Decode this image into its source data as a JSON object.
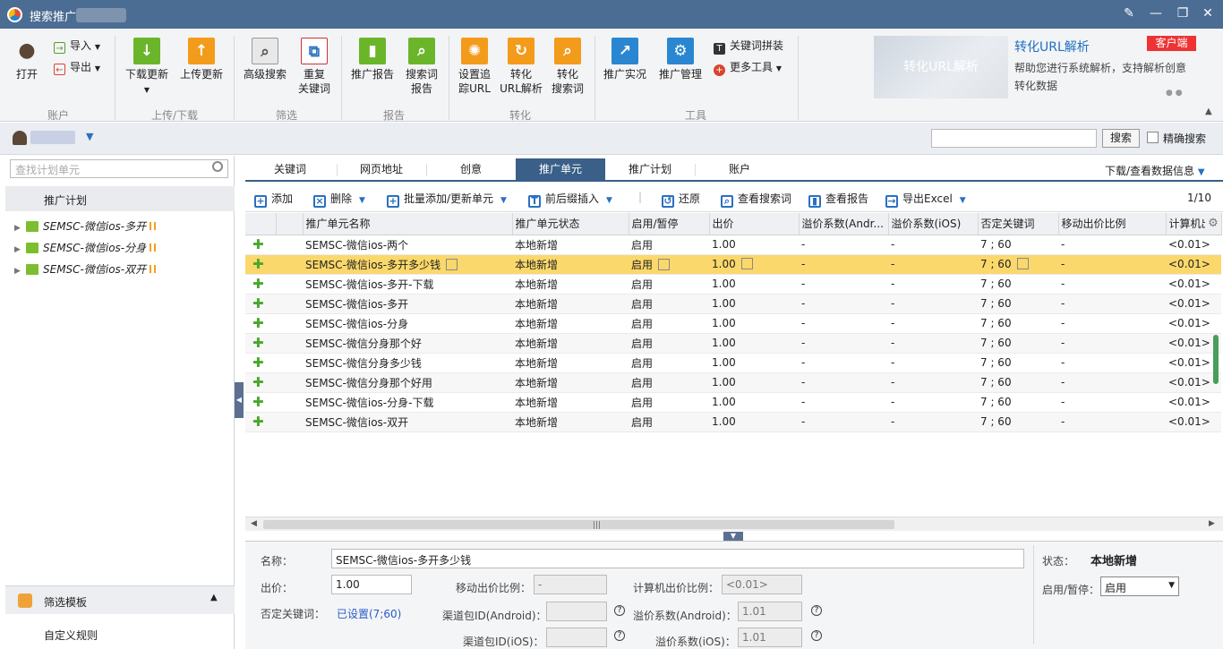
{
  "titlebar": {
    "title": "搜索推广"
  },
  "ribbon": {
    "open": "打开",
    "import": "导入",
    "export": "导出",
    "download_update": "下载更新",
    "upload_update": "上传更新",
    "advanced_search": "高级搜索",
    "repeat_keywords": [
      "重复",
      "关键词"
    ],
    "promo_report": "推广报告",
    "search_term_report": [
      "搜索词",
      "报告"
    ],
    "set_tracking_url": [
      "设置追",
      "踪URL"
    ],
    "convert_url": [
      "转化",
      "URL解析"
    ],
    "convert_search_term": [
      "转化",
      "搜索词"
    ],
    "promo_live": "推广实况",
    "promo_manage": "推广管理",
    "keyword_splice": "关键词拼装",
    "more_tools": "更多工具",
    "groups": [
      "账户",
      "上传/下载",
      "筛选",
      "报告",
      "转化",
      "工具"
    ],
    "banner": {
      "image_text": "转化URL解析",
      "title": "转化URL解析",
      "tag": "客户端",
      "desc": "帮助您进行系统解析，支持解析创意转化数据"
    }
  },
  "userbar": {
    "search_button": "搜索",
    "exact_search": "精确搜索",
    "search_value": ""
  },
  "left": {
    "search_placeholder": "查找计划单元",
    "header": "推广计划",
    "plans": [
      "SEMSC-微信ios-多开",
      "SEMSC-微信ios-分身",
      "SEMSC-微信ios-双开"
    ],
    "filter_template": "筛选模板",
    "custom_rules": "自定义规则"
  },
  "tabs": {
    "items": [
      "关键词",
      "网页地址",
      "创意",
      "推广单元",
      "推广计划",
      "账户"
    ],
    "active": 3,
    "download": "下载/查看数据信息"
  },
  "toolbar": {
    "add": "添加",
    "delete": "删除",
    "batch_add": "批量添加/更新单元",
    "insert": "前后缀插入",
    "restore": "还原",
    "view_search": "查看搜索词",
    "view_report": "查看报告",
    "export": "导出Excel",
    "pager": "1/10"
  },
  "grid": {
    "columns": [
      "推广单元名称",
      "推广单元状态",
      "启用/暂停",
      "出价",
      "溢价系数(Andr...",
      "溢价系数(iOS)",
      "否定关键词",
      "移动出价比例",
      "计算机出"
    ],
    "rows": [
      [
        "SEMSC-微信ios-两个",
        "本地新增",
        "启用",
        "1.00",
        "-",
        "-",
        "7 ; 60",
        "-",
        "<0.01>"
      ],
      [
        "SEMSC-微信ios-多开多少钱",
        "本地新增",
        "启用",
        "1.00",
        "-",
        "-",
        "7 ; 60",
        "-",
        "<0.01>"
      ],
      [
        "SEMSC-微信ios-多开-下载",
        "本地新增",
        "启用",
        "1.00",
        "-",
        "-",
        "7 ; 60",
        "-",
        "<0.01>"
      ],
      [
        "SEMSC-微信ios-多开",
        "本地新增",
        "启用",
        "1.00",
        "-",
        "-",
        "7 ; 60",
        "-",
        "<0.01>"
      ],
      [
        "SEMSC-微信ios-分身",
        "本地新增",
        "启用",
        "1.00",
        "-",
        "-",
        "7 ; 60",
        "-",
        "<0.01>"
      ],
      [
        "SEMSC-微信分身那个好",
        "本地新增",
        "启用",
        "1.00",
        "-",
        "-",
        "7 ; 60",
        "-",
        "<0.01>"
      ],
      [
        "SEMSC-微信分身多少钱",
        "本地新增",
        "启用",
        "1.00",
        "-",
        "-",
        "7 ; 60",
        "-",
        "<0.01>"
      ],
      [
        "SEMSC-微信分身那个好用",
        "本地新增",
        "启用",
        "1.00",
        "-",
        "-",
        "7 ; 60",
        "-",
        "<0.01>"
      ],
      [
        "SEMSC-微信ios-分身-下载",
        "本地新增",
        "启用",
        "1.00",
        "-",
        "-",
        "7 ; 60",
        "-",
        "<0.01>"
      ],
      [
        "SEMSC-微信ios-双开",
        "本地新增",
        "启用",
        "1.00",
        "-",
        "-",
        "7 ; 60",
        "-",
        "<0.01>"
      ]
    ],
    "selected_row": 1
  },
  "detail": {
    "name_label": "名称：",
    "name_value": "SEMSC-微信ios-多开多少钱",
    "bid_label": "出价：",
    "bid_value": "1.00",
    "mobile_ratio_label": "移动出价比例：",
    "mobile_ratio_value": "-",
    "pc_ratio_label": "计算机出价比例：",
    "pc_ratio_value": "<0.01>",
    "neg_kw_label": "否定关键词：",
    "neg_kw_value": "已设置(7;60)",
    "android_pkg_label": "渠道包ID(Android)：",
    "android_prem_label": "溢价系数(Android)：",
    "android_prem_value": "1.01",
    "ios_pkg_label": "渠道包ID(iOS)：",
    "ios_prem_label": "溢价系数(iOS)：",
    "ios_prem_value": "1.01",
    "status_label": "状态：",
    "status_value": "本地新增",
    "enable_label": "启用/暂停：",
    "enable_value": "启用"
  }
}
